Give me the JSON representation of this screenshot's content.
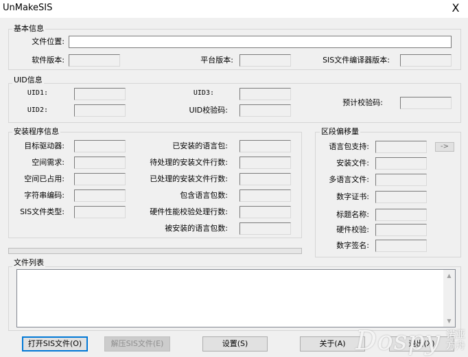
{
  "window": {
    "title": "UnMakeSIS",
    "close_glyph": "X"
  },
  "basic": {
    "group_title": "基本信息",
    "file_location_label": "文件位置:",
    "file_location_value": "",
    "software_version_label": "软件版本:",
    "platform_version_label": "平台版本:",
    "compiler_version_label": "SIS文件编译器版本:"
  },
  "uid": {
    "group_title": "UID信息",
    "uid1_label": "UID1:",
    "uid2_label": "UID2:",
    "uid3_label": "UID3:",
    "uid_check_label": "UID校验码:",
    "precheck_label": "预计校验码:"
  },
  "install": {
    "group_title": "安装程序信息",
    "target_drive_label": "目标驱动器:",
    "space_required_label": "空间需求:",
    "space_used_label": "空间已占用:",
    "string_encoding_label": "字符串编码:",
    "sis_file_type_label": "SIS文件类型:",
    "installed_lang_label": "已安装的语言包:",
    "pending_lines_label": "待处理的安装文件行数:",
    "processed_lines_label": "已处理的安装文件行数:",
    "included_lang_label": "包含语言包数:",
    "hw_check_lines_label": "硬件性能校验处理行数:",
    "installed_lang_count_label": "被安装的语言包数:"
  },
  "offset": {
    "group_title": "区段偏移量",
    "lang_support_label": "语言包支持:",
    "install_file_label": "安装文件:",
    "multilang_file_label": "多语言文件:",
    "cert_label": "数字证书:",
    "title_name_label": "标题名称:",
    "hw_check_label": "硬件校验:",
    "signature_label": "数字签名:",
    "arrow_button": "->"
  },
  "progress": {
    "value": 0
  },
  "file_list": {
    "group_title": "文件列表",
    "items": []
  },
  "buttons": {
    "open": "打开SIS文件(O)",
    "extract": "解压SIS文件(E)",
    "settings": "设置(S)",
    "about": "关于(A)",
    "exit": "退出(X)"
  },
  "watermark": {
    "brand": "Dospy",
    "cn": "诺亚方舟"
  }
}
